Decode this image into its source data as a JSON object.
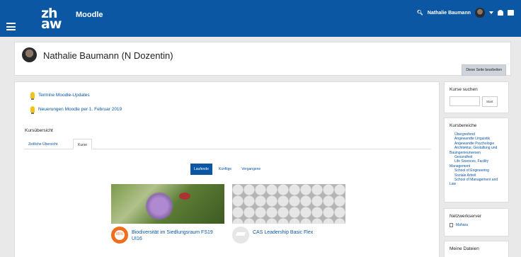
{
  "navbar": {
    "logo_line1": "zh",
    "logo_line2": "aw",
    "brand": "Moodle",
    "user_name": "Nathalie Baumann"
  },
  "header": {
    "title": "Nathalie Baumann (N Dozentin)",
    "edit_button": "Diese Seite bearbeiten"
  },
  "updates": [
    {
      "label": "Termine Moodle-Updates"
    },
    {
      "label": "Neuerungen Moodle per 1. Februar 2019"
    }
  ],
  "overview": {
    "title": "Kursübersicht",
    "tabs": [
      "Zeitliche Übersicht",
      "Kurse"
    ],
    "active_tab": "Kurse",
    "filters": [
      "Laufende",
      "Künftige",
      "Vergangene"
    ],
    "active_filter": "Laufende"
  },
  "courses": [
    {
      "name_line1": "Biodiversität im Siedlungsraum FS19",
      "name_line2": "UI16",
      "progress": "85%"
    },
    {
      "name_line1": "CAS Leadership Basic Flex",
      "name_line2": ""
    }
  ],
  "sidebar": {
    "search_title": "Kurse suchen",
    "search_button": "Start",
    "categories_title": "Kursbereiche",
    "categories": [
      "Übergreifend",
      "Angewandte Linguistik",
      "Angewandte Psychologie",
      "Architektur, Gestaltung und",
      "Bauingenieurwesen",
      "Gesundheit",
      "Life Sciences, Facility",
      "Management",
      "School of Engineering",
      "Soziale Arbeit",
      "School of Management and",
      "Law"
    ],
    "network_title": "Netzwerkserver",
    "network_item": "Mahara",
    "files_title": "Meine Dateien"
  },
  "colors": {
    "primary": "#0b57a4",
    "progress": "#f06d1e"
  }
}
